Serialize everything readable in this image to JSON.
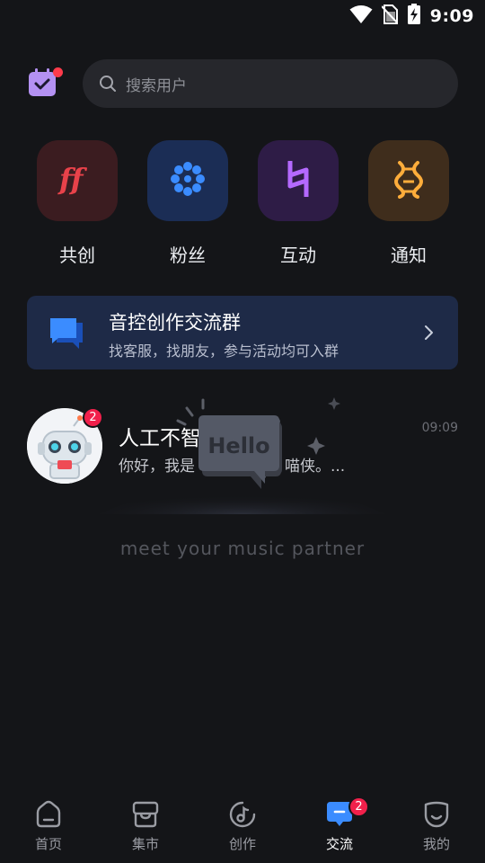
{
  "status_bar": {
    "time": "9:09",
    "icons": [
      "wifi-icon",
      "no-sim-icon",
      "battery-charging-icon"
    ]
  },
  "header": {
    "calendar_icon": "calendar-check-icon",
    "search_placeholder": "搜索用户"
  },
  "quick_actions": [
    {
      "label": "共创",
      "icon": "ff-icon",
      "color": "#e8424a",
      "bg": "#3b1c20"
    },
    {
      "label": "粉丝",
      "icon": "flower-icon",
      "color": "#3b8cff",
      "bg": "#1b2d55"
    },
    {
      "label": "互动",
      "icon": "natural-sign-icon",
      "color": "#b469ff",
      "bg": "#2e1c46"
    },
    {
      "label": "通知",
      "icon": "waveform-icon",
      "color": "#ffad3b",
      "bg": "#3f2d1c"
    }
  ],
  "group_banner": {
    "title": "音控创作交流群",
    "subtitle": "找客服，找朋友，参与活动均可入群",
    "bg": "#1e2a47"
  },
  "conversations": [
    {
      "name": "人工不智",
      "preview_start": "你好，我是",
      "preview_end": "喵侠。...",
      "time": "09:09",
      "badge": "2"
    }
  ],
  "empty_state": {
    "bubble_text": "Hello",
    "tagline": "meet your music partner"
  },
  "bottom_nav": [
    {
      "label": "首页",
      "icon": "home-icon",
      "active": false
    },
    {
      "label": "集市",
      "icon": "market-icon",
      "active": false
    },
    {
      "label": "创作",
      "icon": "music-note-icon",
      "active": false
    },
    {
      "label": "交流",
      "icon": "chat-icon",
      "active": true,
      "badge": "2"
    },
    {
      "label": "我的",
      "icon": "profile-icon",
      "active": false
    }
  ],
  "colors": {
    "background": "#141518",
    "badge": "#f1204b",
    "accent_blue": "#3b8cff"
  }
}
